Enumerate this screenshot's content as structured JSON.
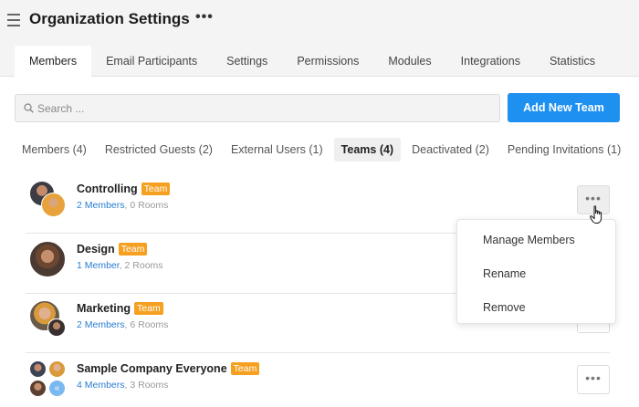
{
  "header": {
    "title": "Organization Settings",
    "more": "•••"
  },
  "tabs": [
    {
      "label": "Members",
      "active": true
    },
    {
      "label": "Email Participants",
      "active": false
    },
    {
      "label": "Settings",
      "active": false
    },
    {
      "label": "Permissions",
      "active": false
    },
    {
      "label": "Modules",
      "active": false
    },
    {
      "label": "Integrations",
      "active": false
    },
    {
      "label": "Statistics",
      "active": false
    }
  ],
  "search": {
    "placeholder": "Search ..."
  },
  "add_team_button": "Add New Team",
  "subtabs": [
    {
      "label": "Members (4)",
      "active": false
    },
    {
      "label": "Restricted Guests (2)",
      "active": false
    },
    {
      "label": "External Users (1)",
      "active": false
    },
    {
      "label": "Teams (4)",
      "active": true
    },
    {
      "label": "Deactivated (2)",
      "active": false
    },
    {
      "label": "Pending Invitations (1)",
      "active": false
    }
  ],
  "teams": [
    {
      "name": "Controlling",
      "badge": "Team",
      "members": "2 Members",
      "rooms": "0 Rooms"
    },
    {
      "name": "Design",
      "badge": "Team",
      "members": "1 Member",
      "rooms": "2 Rooms"
    },
    {
      "name": "Marketing",
      "badge": "Team",
      "members": "2 Members",
      "rooms": "6 Rooms"
    },
    {
      "name": "Sample Company Everyone",
      "badge": "Team",
      "members": "4 Members",
      "rooms": "3 Rooms"
    }
  ],
  "context_menu": {
    "items": [
      "Manage Members",
      "Rename",
      "Remove"
    ]
  },
  "more_label": "•••",
  "colors": {
    "accent": "#1e90f0",
    "badge": "#f5a020",
    "link": "#2a7ed1"
  }
}
